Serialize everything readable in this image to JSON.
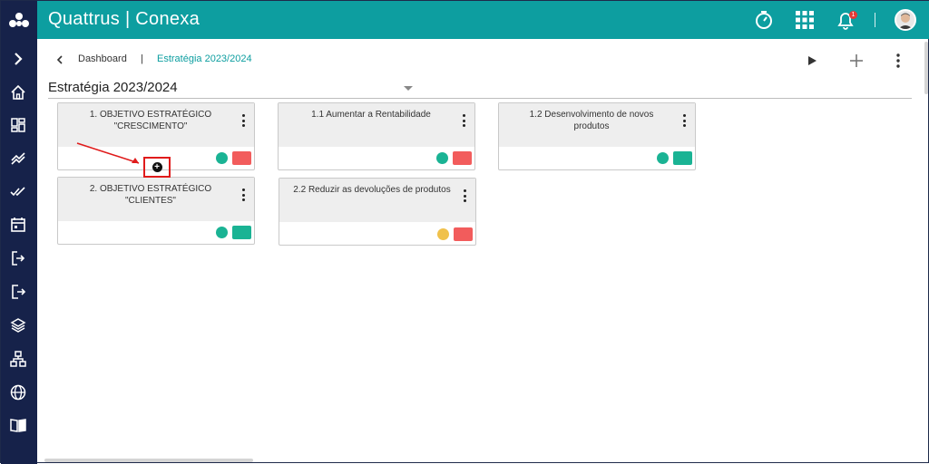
{
  "app": {
    "title": "Quattrus | Conexa",
    "notification_count": "1"
  },
  "breadcrumb": {
    "home": "Dashboard",
    "separator": "|",
    "current": "Estratégia 2023/2024"
  },
  "page": {
    "title": "Estratégia 2023/2024"
  },
  "sidebar": {
    "items": [
      "expand-icon",
      "home-icon",
      "dashboard-icon",
      "trend-icon",
      "check-icon",
      "calendar-icon",
      "login-icon",
      "logout-icon",
      "layers-icon",
      "sitemap-icon",
      "globe-icon",
      "book-icon"
    ]
  },
  "cards": [
    {
      "title": "1. OBJETIVO ESTRATÉGICO \"CRESCIMENTO\"",
      "dot_color": "#1ab394",
      "rect_color": "#f25c5c"
    },
    {
      "title": "1.1 Aumentar a Rentabilidade",
      "dot_color": "#1ab394",
      "rect_color": "#f25c5c"
    },
    {
      "title": "1.2 Desenvolvimento de novos produtos",
      "dot_color": "#1ab394",
      "rect_color": "#1ab394"
    },
    {
      "title": "2. OBJETIVO ESTRATÉGICO \"CLIENTES\"",
      "dot_color": "#1ab394",
      "rect_color": "#1ab394"
    },
    {
      "title": "2.2 Reduzir as devoluções de produtos",
      "dot_color": "#f0c14b",
      "rect_color": "#f25c5c"
    }
  ],
  "colors": {
    "topbar": "#0d9ea0",
    "sidebar": "#16224a",
    "accent": "#0d9ea0",
    "highlight": "#e01b1b"
  }
}
